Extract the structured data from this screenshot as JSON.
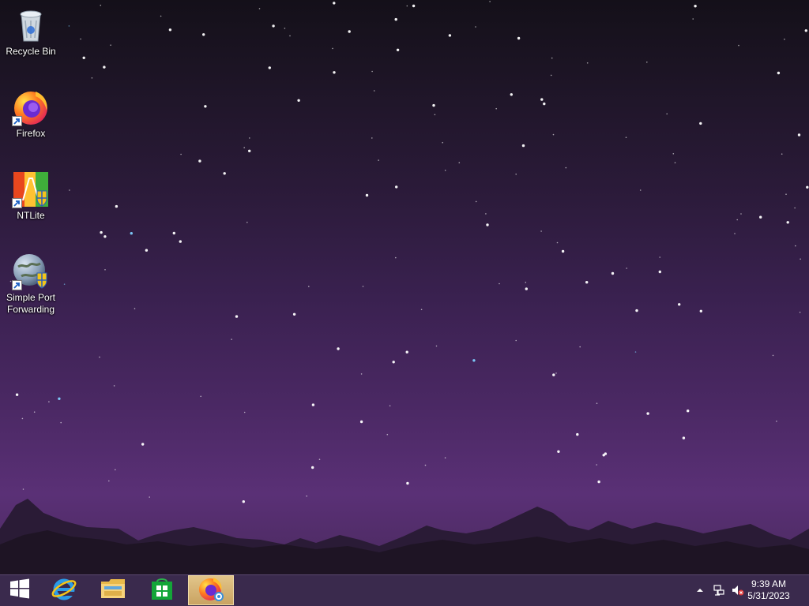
{
  "desktop": {
    "icons": [
      {
        "label": "Recycle Bin",
        "icon": "recycle-bin-icon",
        "shortcut": false
      },
      {
        "label": "Firefox",
        "icon": "firefox-icon",
        "shortcut": true
      },
      {
        "label": "NTLite",
        "icon": "ntlite-icon",
        "shortcut": true
      },
      {
        "label": "Simple Port Forwarding",
        "icon": "globe-icon",
        "shortcut": true
      }
    ]
  },
  "taskbar": {
    "pinned": [
      {
        "icon": "windows-start-icon"
      },
      {
        "icon": "internet-explorer-icon"
      },
      {
        "icon": "file-explorer-icon"
      },
      {
        "icon": "store-icon"
      },
      {
        "icon": "firefox-icon",
        "active": true
      }
    ],
    "tray": {
      "icons": [
        "show-hidden-icons-arrow",
        "network-icon",
        "volume-muted-icon"
      ],
      "time": "9:39 AM",
      "date": "5/31/2023"
    }
  },
  "colors": {
    "taskbar": "#3a2a4d",
    "sky_top": "#141019",
    "sky_bottom": "#5a3076",
    "mountains": "#1e1424"
  }
}
